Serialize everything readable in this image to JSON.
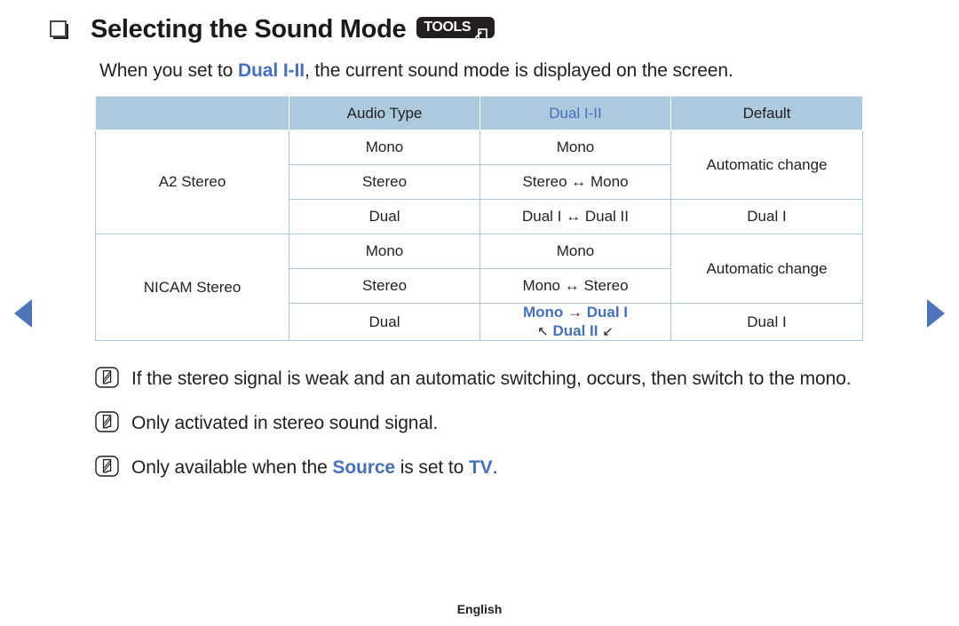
{
  "nav": {
    "prev_label": "previous page",
    "next_label": "next page"
  },
  "header": {
    "bullet": "square-bullet-icon",
    "title": "Selecting the Sound Mode",
    "tools_badge": {
      "label": "TOOLS",
      "icon": "tools-enter-icon"
    }
  },
  "intro": {
    "before": "When you set to ",
    "highlight": "Dual I-II",
    "after": ", the current sound mode is displayed on the screen."
  },
  "table": {
    "headers": [
      "",
      "Audio Type",
      "Dual I-II",
      "Default"
    ],
    "groups": [
      {
        "name": "A2 Stereo",
        "rows": [
          {
            "audio_type": "Mono",
            "dual": "Mono",
            "default": "Automatic change"
          },
          {
            "audio_type": "Stereo",
            "dual": "Stereo ↔ Mono",
            "default": ""
          },
          {
            "audio_type": "Dual",
            "dual": "Dual I ↔ Dual II",
            "default": "Dual I"
          }
        ]
      },
      {
        "name": "NICAM Stereo",
        "rows": [
          {
            "audio_type": "Mono",
            "dual": "Mono",
            "default": "Automatic change"
          },
          {
            "audio_type": "Stereo",
            "dual": "Mono ↔ Stereo",
            "default": ""
          },
          {
            "audio_type": "Dual",
            "dual_line1_a": "Mono",
            "dual_line1_arrow": "→",
            "dual_line1_b": "Dual I",
            "dual_line2_left": "↖",
            "dual_line2_mid": "Dual II",
            "dual_line2_right": "↙",
            "default": "Dual I"
          }
        ]
      }
    ]
  },
  "notes": [
    {
      "icon": "note-pencil-icon",
      "text": "If the stereo signal is weak and an automatic switching, occurs, then switch to the mono."
    },
    {
      "icon": "note-pencil-icon",
      "text": "Only activated in stereo sound signal."
    },
    {
      "icon": "note-pencil-icon",
      "before": "Only available when the ",
      "highlight1": "Source",
      "middle": " is set to ",
      "highlight2": "TV",
      "after": "."
    }
  ],
  "footer": {
    "language": "English"
  },
  "colors": {
    "accent_blue": "#4770b8",
    "table_header_bg": "#adc9dd",
    "table_border": "#a9c7dd",
    "text": "#231f20",
    "nav_arrow": "#4f74b8"
  }
}
